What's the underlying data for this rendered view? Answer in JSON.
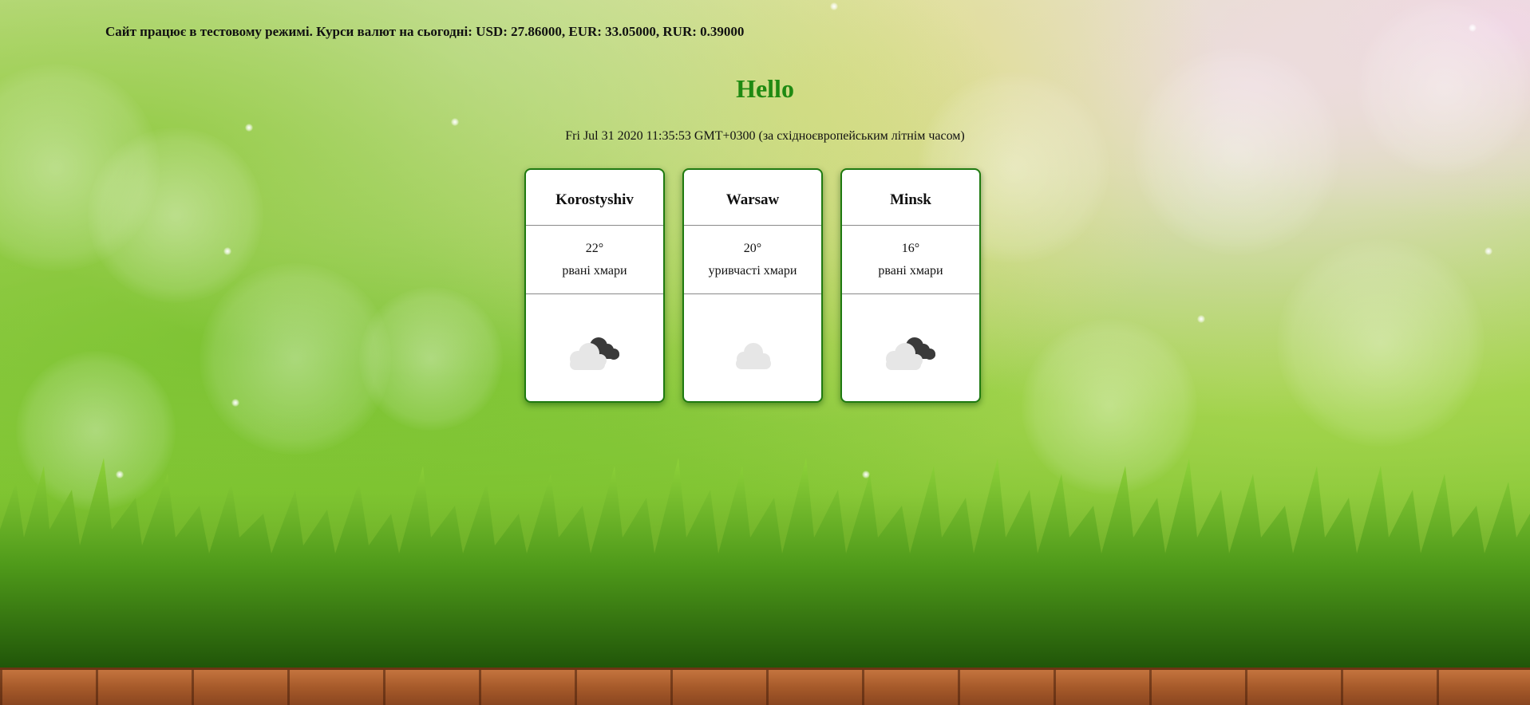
{
  "banner": {
    "text": "Сайт працює в тестовому режимі. Курси валют на сьогодні: USD: 27.86000, EUR: 33.05000, RUR: 0.39000"
  },
  "header": {
    "greeting": "Hello",
    "datetime": "Fri Jul 31 2020 11:35:53 GMT+0300 (за східноєвропейським літнім часом)"
  },
  "weather": {
    "cities": [
      {
        "name": "Korostyshiv",
        "temp": "22°",
        "description": "рвані хмари",
        "icon": "broken-clouds-icon"
      },
      {
        "name": "Warsaw",
        "temp": "20°",
        "description": "уривчасті хмари",
        "icon": "scattered-clouds-icon"
      },
      {
        "name": "Minsk",
        "temp": "16°",
        "description": "рвані хмари",
        "icon": "broken-clouds-icon"
      }
    ]
  },
  "colors": {
    "accent": "#1f8a12",
    "card_border": "#1f7a10",
    "card_background": "#ffffff"
  }
}
